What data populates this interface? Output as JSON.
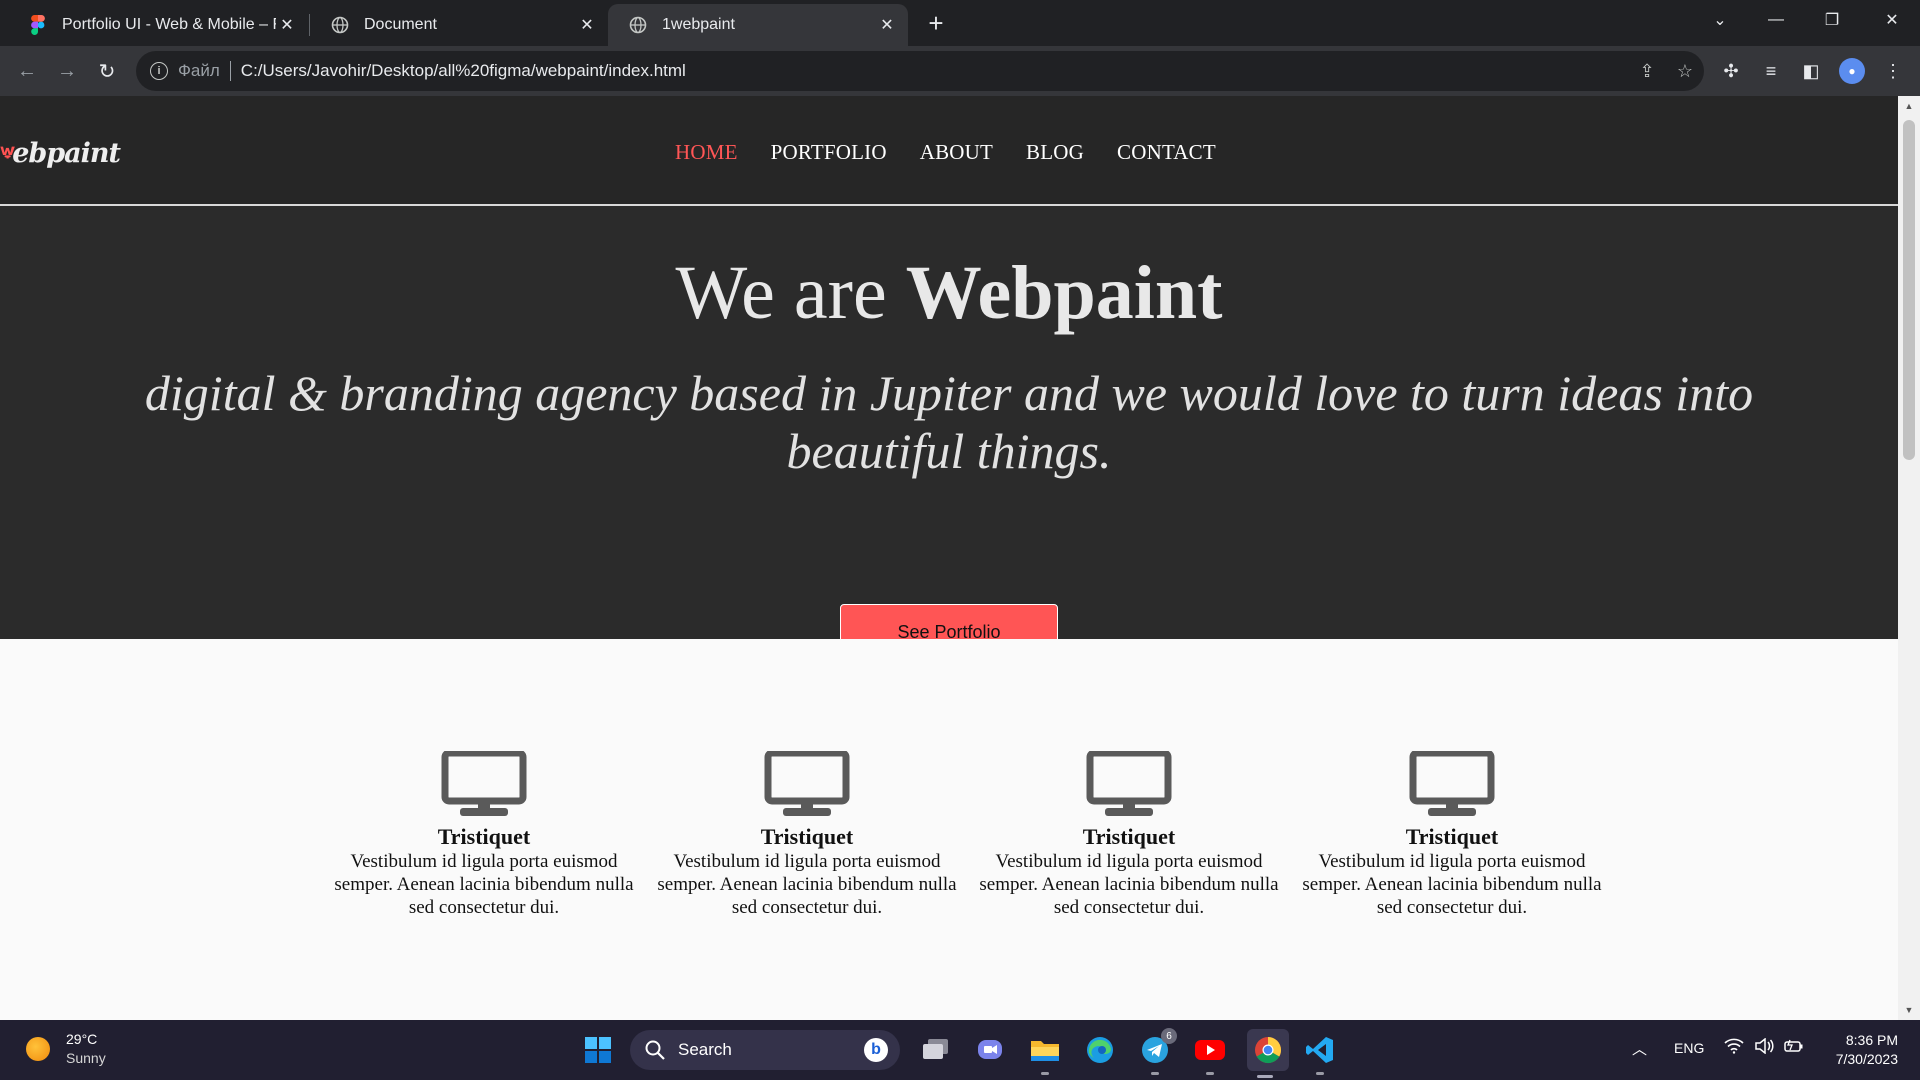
{
  "browser": {
    "tabs": [
      {
        "title": "Portfolio UI - Web & Mobile – Fig",
        "active": false
      },
      {
        "title": "Document",
        "active": false
      },
      {
        "title": "1webpaint",
        "active": true
      }
    ],
    "address": {
      "scheme_label": "Файл",
      "url": "C:/Users/Javohir/Desktop/all%20figma/webpaint/index.html"
    }
  },
  "site": {
    "logo": {
      "letter": "W",
      "text": "ebpaint"
    },
    "nav": [
      "HOME",
      "PORTFOLIO",
      "ABOUT",
      "BLOG",
      "CONTACT"
    ],
    "active_nav": "HOME",
    "hero": {
      "title_prefix": "We are",
      "title_brand": "Webpaint",
      "tagline": "digital & branding agency based in Jupiter and we would love to turn ideas into beautiful things.",
      "cta": "See Portfolio"
    },
    "features": [
      {
        "icon": "monitor-icon",
        "title": "Tristiquet",
        "text": "Vestibulum id ligula porta euismod semper. Aenean lacinia bibendum nulla sed consectetur dui."
      },
      {
        "icon": "monitor-icon",
        "title": "Tristiquet",
        "text": "Vestibulum id ligula porta euismod semper. Aenean lacinia bibendum nulla sed consectetur dui."
      },
      {
        "icon": "monitor-icon",
        "title": "Tristiquet",
        "text": "Vestibulum id ligula porta euismod semper. Aenean lacinia bibendum nulla sed consectetur dui."
      },
      {
        "icon": "monitor-icon",
        "title": "Tristiquet",
        "text": "Vestibulum id ligula porta euismod semper. Aenean lacinia bibendum nulla sed consectetur dui."
      }
    ]
  },
  "taskbar": {
    "weather": {
      "temp": "29°C",
      "condition": "Sunny"
    },
    "search_placeholder": "Search",
    "telegram_badge": "6",
    "language": "ENG",
    "time": "8:36 PM",
    "date": "7/30/2023"
  },
  "colors": {
    "accent": "#ff5555",
    "header_bg": "#262626",
    "hero_bg": "#2b2b2b",
    "chrome_bg": "#202124",
    "taskbar_bg": "#211f31"
  }
}
